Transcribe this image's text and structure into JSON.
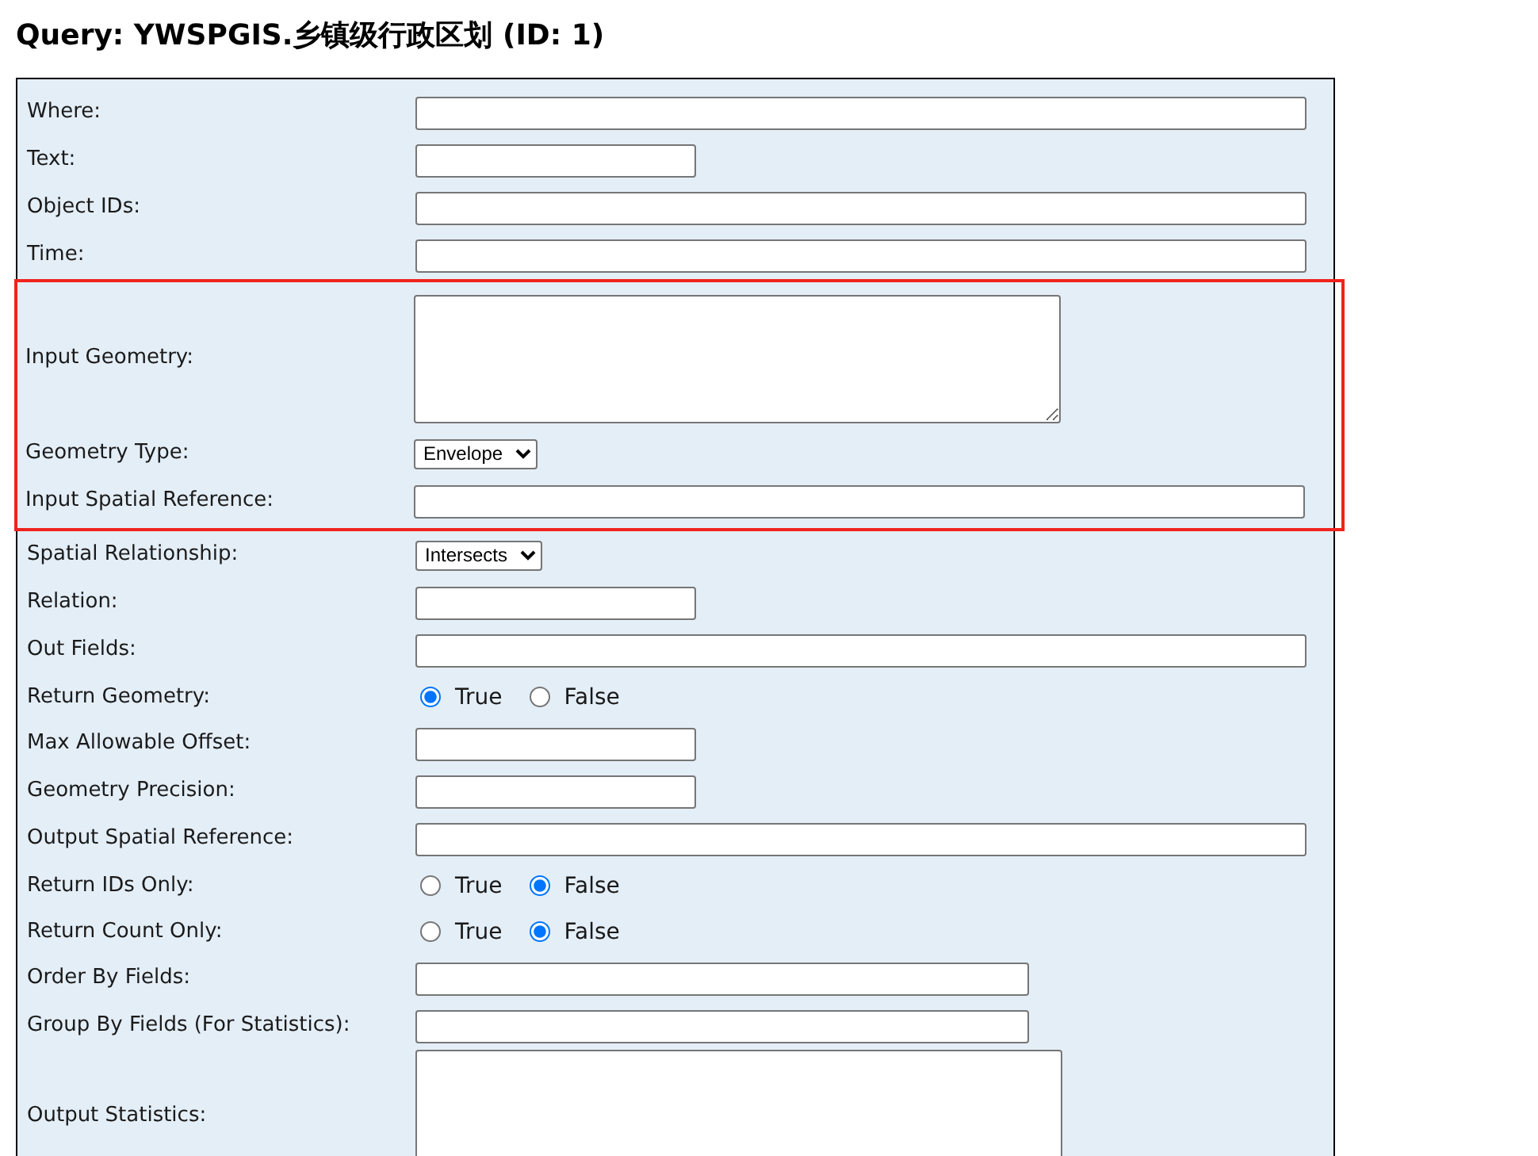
{
  "title": "Query: YWSPGIS.乡镇级行政区划 (ID: 1)",
  "sections": [
    {
      "highlighted": false,
      "rows": [
        {
          "label": "Where:",
          "kind": "longtext"
        },
        {
          "label": "Text:",
          "kind": "shorttext"
        },
        {
          "label": "Object IDs:",
          "kind": "longtext"
        },
        {
          "label": "Time:",
          "kind": "longtext"
        }
      ]
    },
    {
      "highlighted": true,
      "rows": [
        {
          "label": "Input Geometry:",
          "kind": "textarea"
        },
        {
          "label": "Geometry Type:",
          "kind": "select",
          "value": "Envelope"
        },
        {
          "label": "Input Spatial Reference:",
          "kind": "longtext"
        }
      ]
    },
    {
      "highlighted": false,
      "rows": [
        {
          "label": "Spatial Relationship:",
          "kind": "select",
          "value": "Intersects"
        },
        {
          "label": "Relation:",
          "kind": "shorttext"
        },
        {
          "label": "Out Fields:",
          "kind": "longtext"
        },
        {
          "label": "Return Geometry:",
          "kind": "radio",
          "options": [
            {
              "label": "True",
              "selected": true
            },
            {
              "label": "False",
              "selected": false
            }
          ]
        },
        {
          "label": "Max Allowable Offset:",
          "kind": "shorttext"
        },
        {
          "label": "Geometry Precision:",
          "kind": "shorttext"
        },
        {
          "label": "Output Spatial Reference:",
          "kind": "longtext"
        },
        {
          "label": "Return IDs Only:",
          "kind": "radio",
          "options": [
            {
              "label": "True",
              "selected": false
            },
            {
              "label": "False",
              "selected": true
            }
          ]
        },
        {
          "label": "Return Count Only:",
          "kind": "radio",
          "options": [
            {
              "label": "True",
              "selected": false
            },
            {
              "label": "False",
              "selected": true
            }
          ]
        },
        {
          "label": "Order By Fields:",
          "kind": "midtext"
        },
        {
          "label": "Group By Fields (For Statistics):",
          "kind": "midtext"
        },
        {
          "label": "Output Statistics:",
          "kind": "textarea"
        }
      ]
    }
  ]
}
